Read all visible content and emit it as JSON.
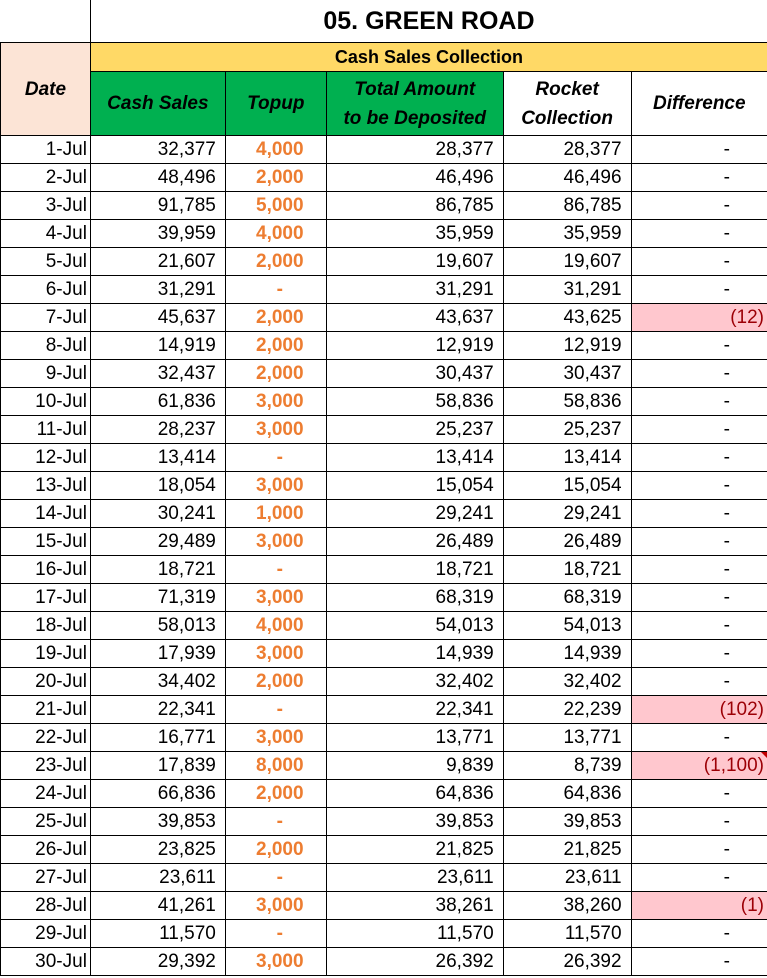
{
  "title": "05. GREEN ROAD",
  "group_header": "Cash Sales Collection",
  "headers": {
    "date": "Date",
    "cash_sales": "Cash Sales",
    "topup": "Topup",
    "total_line1": "Total Amount",
    "total_line2": "to be Deposited",
    "rocket_line1": "Rocket",
    "rocket_line2": "Collection",
    "difference": "Difference"
  },
  "rows": [
    {
      "date": "1-Jul",
      "cash": "32,377",
      "topup": "4,000",
      "total": "28,377",
      "rocket": "28,377",
      "diff": "-"
    },
    {
      "date": "2-Jul",
      "cash": "48,496",
      "topup": "2,000",
      "total": "46,496",
      "rocket": "46,496",
      "diff": "-"
    },
    {
      "date": "3-Jul",
      "cash": "91,785",
      "topup": "5,000",
      "total": "86,785",
      "rocket": "86,785",
      "diff": "-"
    },
    {
      "date": "4-Jul",
      "cash": "39,959",
      "topup": "4,000",
      "total": "35,959",
      "rocket": "35,959",
      "diff": "-"
    },
    {
      "date": "5-Jul",
      "cash": "21,607",
      "topup": "2,000",
      "total": "19,607",
      "rocket": "19,607",
      "diff": "-"
    },
    {
      "date": "6-Jul",
      "cash": "31,291",
      "topup": "-",
      "total": "31,291",
      "rocket": "31,291",
      "diff": "-"
    },
    {
      "date": "7-Jul",
      "cash": "45,637",
      "topup": "2,000",
      "total": "43,637",
      "rocket": "43,625",
      "diff": "(12)"
    },
    {
      "date": "8-Jul",
      "cash": "14,919",
      "topup": "2,000",
      "total": "12,919",
      "rocket": "12,919",
      "diff": "-"
    },
    {
      "date": "9-Jul",
      "cash": "32,437",
      "topup": "2,000",
      "total": "30,437",
      "rocket": "30,437",
      "diff": "-"
    },
    {
      "date": "10-Jul",
      "cash": "61,836",
      "topup": "3,000",
      "total": "58,836",
      "rocket": "58,836",
      "diff": "-"
    },
    {
      "date": "11-Jul",
      "cash": "28,237",
      "topup": "3,000",
      "total": "25,237",
      "rocket": "25,237",
      "diff": "-"
    },
    {
      "date": "12-Jul",
      "cash": "13,414",
      "topup": "-",
      "total": "13,414",
      "rocket": "13,414",
      "diff": "-"
    },
    {
      "date": "13-Jul",
      "cash": "18,054",
      "topup": "3,000",
      "total": "15,054",
      "rocket": "15,054",
      "diff": "-"
    },
    {
      "date": "14-Jul",
      "cash": "30,241",
      "topup": "1,000",
      "total": "29,241",
      "rocket": "29,241",
      "diff": "-"
    },
    {
      "date": "15-Jul",
      "cash": "29,489",
      "topup": "3,000",
      "total": "26,489",
      "rocket": "26,489",
      "diff": "-"
    },
    {
      "date": "16-Jul",
      "cash": "18,721",
      "topup": "-",
      "total": "18,721",
      "rocket": "18,721",
      "diff": "-"
    },
    {
      "date": "17-Jul",
      "cash": "71,319",
      "topup": "3,000",
      "total": "68,319",
      "rocket": "68,319",
      "diff": "-"
    },
    {
      "date": "18-Jul",
      "cash": "58,013",
      "topup": "4,000",
      "total": "54,013",
      "rocket": "54,013",
      "diff": "-"
    },
    {
      "date": "19-Jul",
      "cash": "17,939",
      "topup": "3,000",
      "total": "14,939",
      "rocket": "14,939",
      "diff": "-"
    },
    {
      "date": "20-Jul",
      "cash": "34,402",
      "topup": "2,000",
      "total": "32,402",
      "rocket": "32,402",
      "diff": "-"
    },
    {
      "date": "21-Jul",
      "cash": "22,341",
      "topup": "-",
      "total": "22,341",
      "rocket": "22,239",
      "diff": "(102)"
    },
    {
      "date": "22-Jul",
      "cash": "16,771",
      "topup": "3,000",
      "total": "13,771",
      "rocket": "13,771",
      "diff": "-"
    },
    {
      "date": "23-Jul",
      "cash": "17,839",
      "topup": "8,000",
      "total": "9,839",
      "rocket": "8,739",
      "diff": "(1,100)"
    },
    {
      "date": "24-Jul",
      "cash": "66,836",
      "topup": "2,000",
      "total": "64,836",
      "rocket": "64,836",
      "diff": "-"
    },
    {
      "date": "25-Jul",
      "cash": "39,853",
      "topup": "-",
      "total": "39,853",
      "rocket": "39,853",
      "diff": "-"
    },
    {
      "date": "26-Jul",
      "cash": "23,825",
      "topup": "2,000",
      "total": "21,825",
      "rocket": "21,825",
      "diff": "-"
    },
    {
      "date": "27-Jul",
      "cash": "23,611",
      "topup": "-",
      "total": "23,611",
      "rocket": "23,611",
      "diff": "-"
    },
    {
      "date": "28-Jul",
      "cash": "41,261",
      "topup": "3,000",
      "total": "38,261",
      "rocket": "38,260",
      "diff": "(1)"
    },
    {
      "date": "29-Jul",
      "cash": "11,570",
      "topup": "-",
      "total": "11,570",
      "rocket": "11,570",
      "diff": "-"
    },
    {
      "date": "30-Jul",
      "cash": "29,392",
      "topup": "3,000",
      "total": "26,392",
      "rocket": "26,392",
      "diff": "-"
    }
  ],
  "colors": {
    "subheader_fill": "#ffd966",
    "column_header_fill": "#00b050",
    "date_header_fill": "#fce4d6",
    "topup_text": "#ed7d31",
    "negative_fill": "#ffc7ce",
    "negative_text": "#9c0006"
  }
}
